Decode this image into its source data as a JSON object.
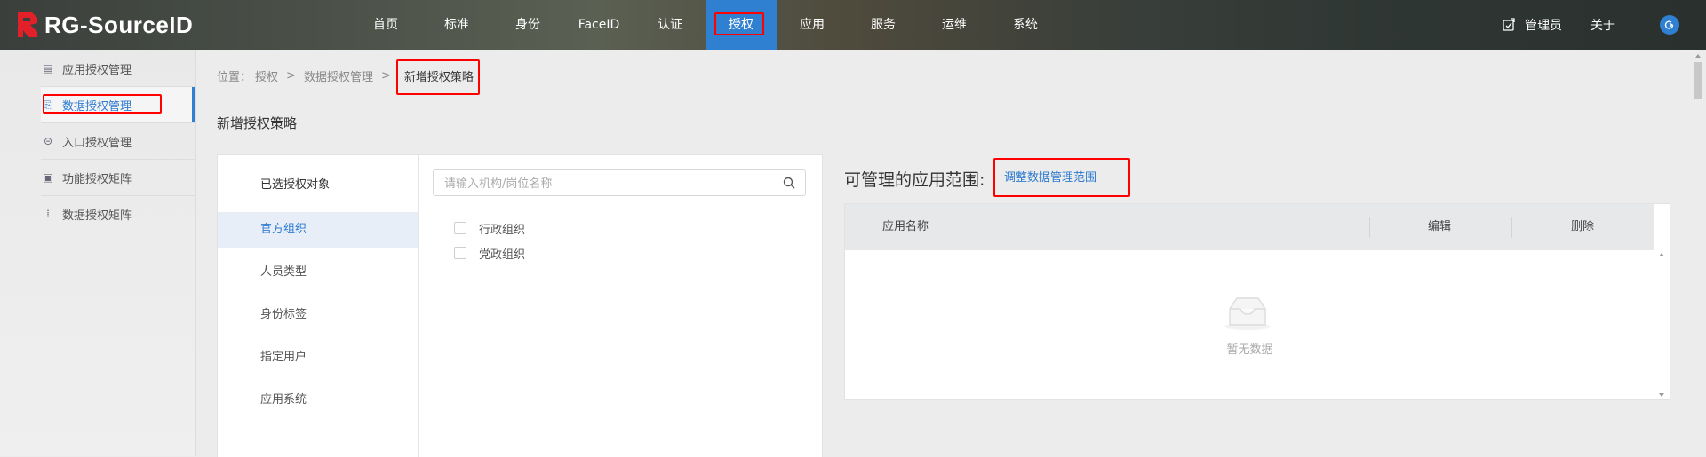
{
  "app": {
    "logo_text": "RG-SourceID"
  },
  "nav": {
    "items": [
      "首页",
      "标准",
      "身份",
      "FaceID",
      "认证",
      "授权",
      "应用",
      "服务",
      "运维",
      "系统"
    ],
    "active_index": 5
  },
  "topRight": {
    "admin_label": "管理员",
    "about_label": "关于"
  },
  "sidebar": {
    "items": [
      {
        "label": "应用授权管理",
        "icon": "app-auth-icon"
      },
      {
        "label": "数据授权管理",
        "icon": "data-auth-icon"
      },
      {
        "label": "入口授权管理",
        "icon": "entry-auth-icon"
      },
      {
        "label": "功能授权矩阵",
        "icon": "function-matrix-icon"
      },
      {
        "label": "数据授权矩阵",
        "icon": "data-matrix-icon"
      }
    ],
    "active_index": 1
  },
  "breadcrumb": {
    "prefix": "位置：",
    "items": [
      "授权",
      "数据授权管理",
      "新增授权策略"
    ],
    "separator": ">"
  },
  "page": {
    "title": "新增授权策略"
  },
  "objectPanel": {
    "header": "已选授权对象",
    "tabs": [
      "官方组织",
      "人员类型",
      "身份标签",
      "指定用户",
      "应用系统"
    ],
    "active_tab": 0,
    "search_placeholder": "请输入机构/岗位名称",
    "options": [
      "行政组织",
      "党政组织"
    ]
  },
  "scope": {
    "title": "可管理的应用范围:",
    "adjust_link": "调整数据管理范围",
    "columns": [
      "应用名称",
      "编辑",
      "删除"
    ],
    "empty_text": "暂无数据"
  },
  "colors": {
    "accent": "#2f80d1",
    "highlight": "#ff0000"
  }
}
